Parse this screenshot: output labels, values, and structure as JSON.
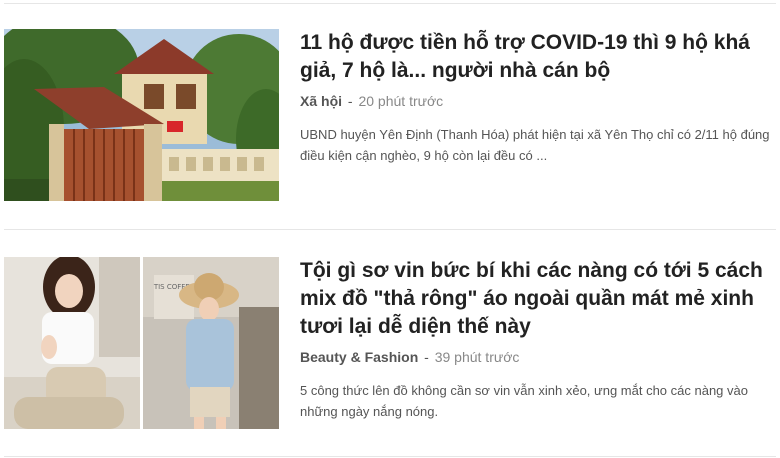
{
  "articles": [
    {
      "title": "11 hộ được tiền hỗ trợ COVID-19 thì 9 hộ khá giả, 7 hộ là... người nhà cán bộ",
      "category": "Xã hội",
      "separator": "-",
      "time": "20 phút trước",
      "summary": "UBND huyện Yên Định (Thanh Hóa) phát hiện tại xã Yên Thọ chỉ có 2/11 hộ đúng điều kiện cận nghèo, 9 hộ còn lại đều có ..."
    },
    {
      "title": "Tội gì sơ vin bức bí khi các nàng có tới 5 cách mix đồ \"thả rông\" áo ngoài quần mát mẻ xinh tươi lại dễ diện thế này",
      "category": "Beauty & Fashion",
      "separator": "-",
      "time": "39 phút trước",
      "summary": "5 công thức lên đồ không cần sơ vin vẫn xinh xẻo, ưng mắt cho các nàng vào những ngày nắng nóng.",
      "photo_text": "TIS COFFEE"
    }
  ]
}
